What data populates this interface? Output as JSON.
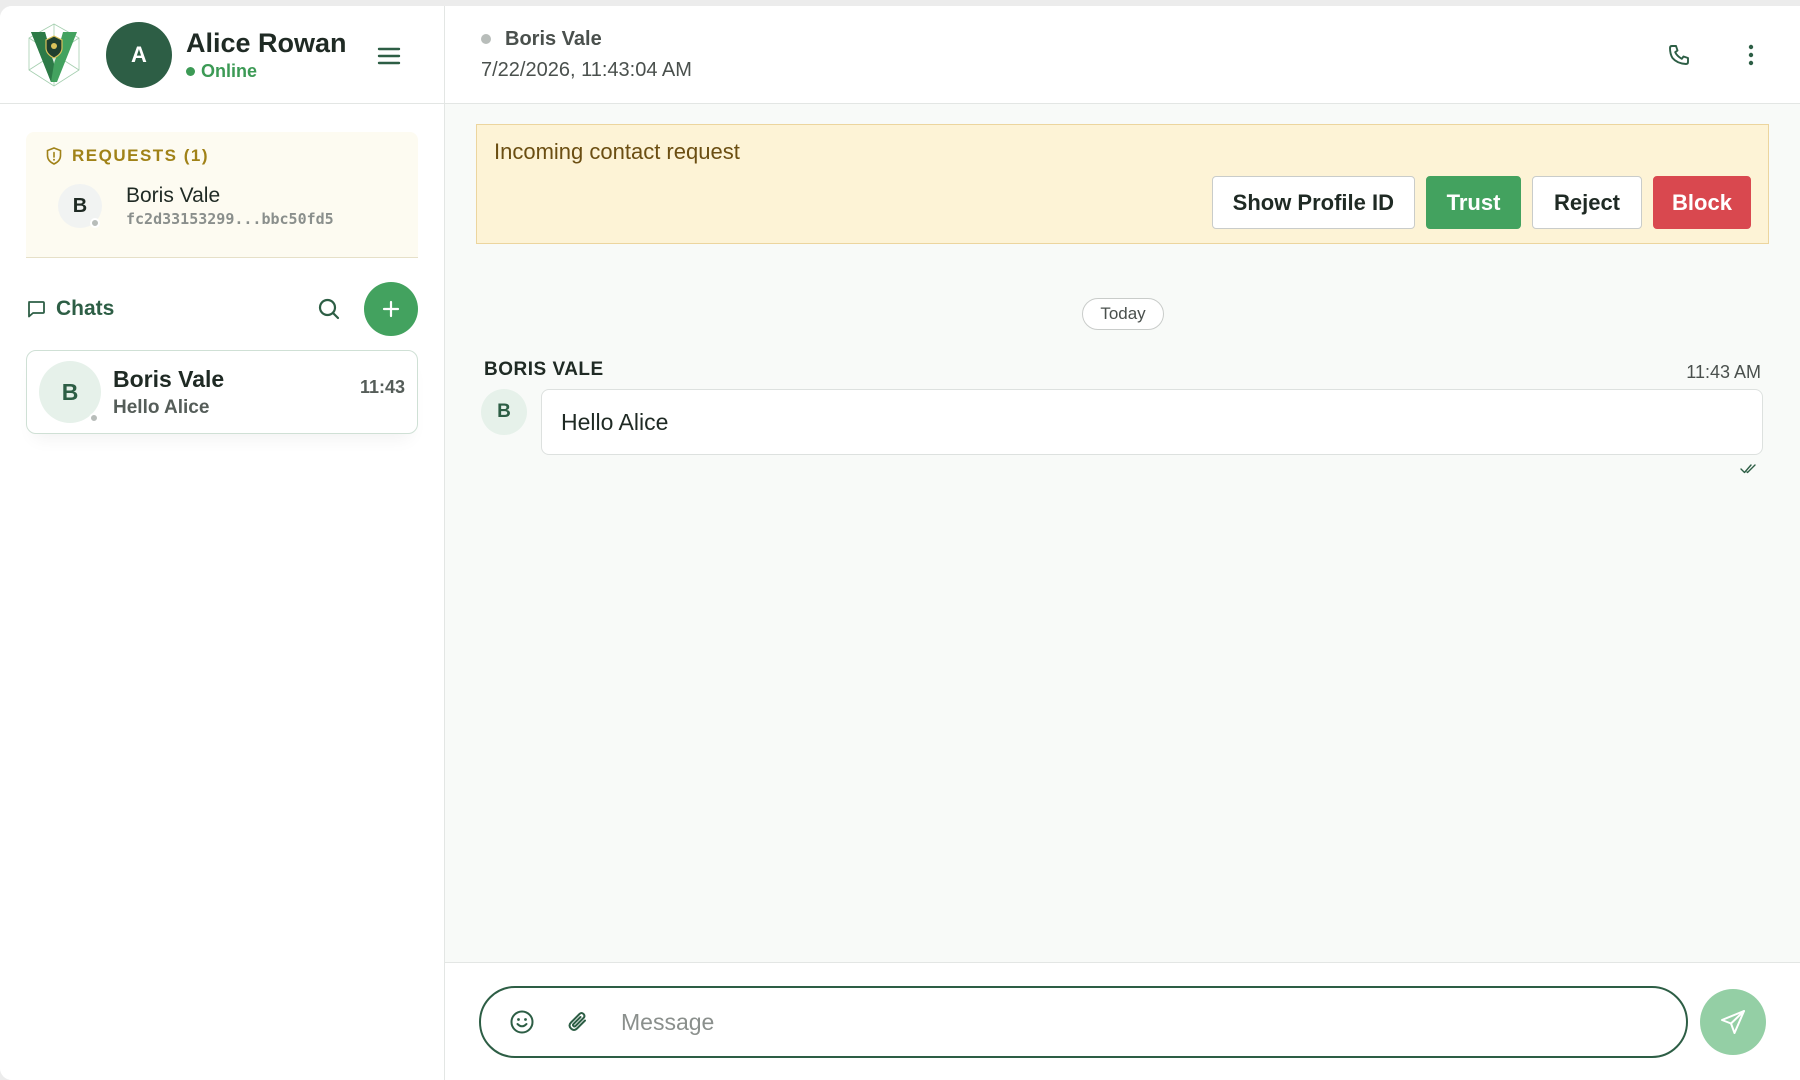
{
  "colors": {
    "brand_dark": "#2d5e45",
    "brand": "#43a25f",
    "online": "#3c9a55",
    "warning_bg": "#fdf3d6",
    "danger": "#d9484f"
  },
  "profile": {
    "avatar_initial": "A",
    "name": "Alice Rowan",
    "status": "Online",
    "logo_icon": "shield-v-logo",
    "menu_icon": "hamburger-menu-icon"
  },
  "requests": {
    "title": "REQUESTS (1)",
    "items": [
      {
        "initial": "B",
        "name": "Boris Vale",
        "id": "fc2d33153299...bbc50fd5"
      }
    ]
  },
  "chats": {
    "title": "Chats",
    "items": [
      {
        "initial": "B",
        "name": "Boris Vale",
        "preview": "Hello Alice",
        "time": "11:43"
      }
    ]
  },
  "chat_header": {
    "name": "Boris Vale",
    "timestamp": "7/22/2026, 11:43:04 AM"
  },
  "banner": {
    "text": "Incoming contact request",
    "show_id_label": "Show Profile ID",
    "trust_label": "Trust",
    "reject_label": "Reject",
    "block_label": "Block"
  },
  "conversation": {
    "day_label": "Today",
    "messages": [
      {
        "sender": "BORIS VALE",
        "initial": "B",
        "time": "11:43 AM",
        "text": "Hello Alice",
        "status": "read"
      }
    ]
  },
  "composer": {
    "placeholder": "Message"
  }
}
